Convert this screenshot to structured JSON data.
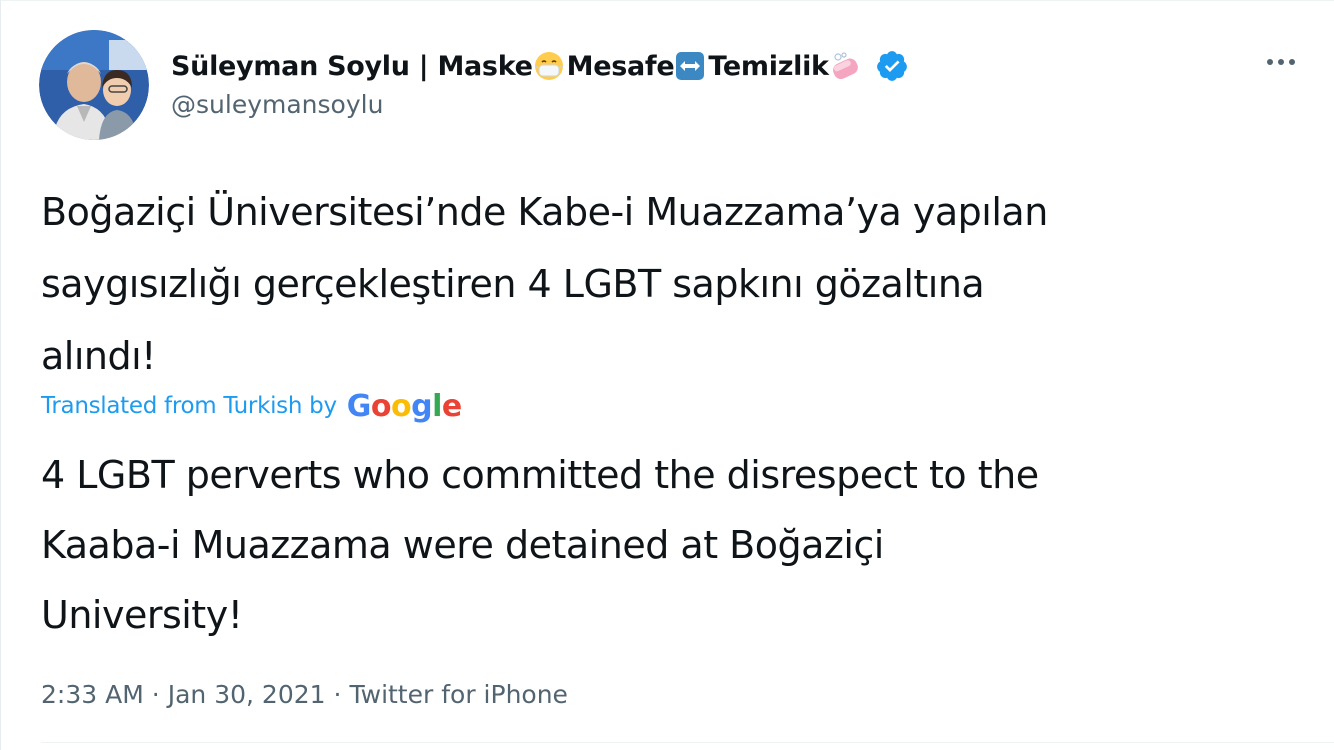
{
  "tweet": {
    "author": {
      "display_name_parts": {
        "part1": "Süleyman Soylu | Maske",
        "part2": " Mesafe",
        "part3": " Temizlik"
      },
      "handle": "@suleymansoylu",
      "verified": true,
      "emojis": [
        "face-with-medical-mask-icon",
        "left-right-arrow-icon",
        "soap-icon"
      ]
    },
    "text": "Boğaziçi Üniversitesi’nde Kabe-i Muazzama’ya yapılan\nsaygısızlığı gerçekleştiren 4 LGBT sapkını gözaltına\nalındı!",
    "translation": {
      "label": "Translated from Turkish by",
      "provider": "Google",
      "text": "4 LGBT perverts who committed the disrespect to the\nKaaba-i Muazzama were detained at Boğaziçi\nUniversity!"
    },
    "meta": {
      "time": "2:33 AM",
      "separator": "·",
      "date": "Jan 30, 2021",
      "source": "Twitter for iPhone"
    }
  },
  "colors": {
    "text_primary": "#0f1419",
    "text_secondary": "#536471",
    "accent": "#1d9bf0",
    "verified_badge": "#1d9bf0",
    "google_blue": "#4285f4",
    "google_red": "#ea4335",
    "google_yellow": "#fbbc05",
    "google_green": "#34a853"
  }
}
